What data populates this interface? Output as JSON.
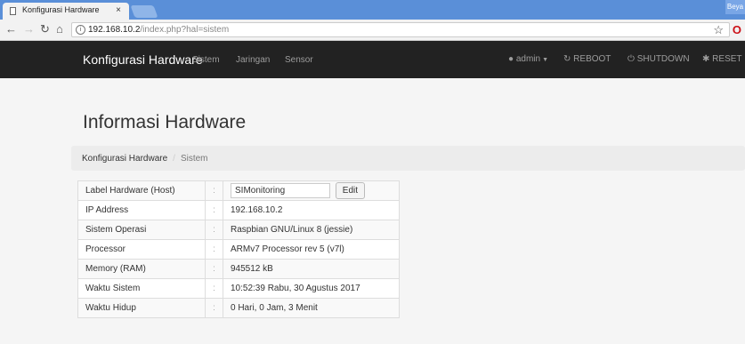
{
  "browser": {
    "tab_title": "Konfigurasi Hardware",
    "tab_close": "×",
    "window_user": "Beya",
    "url_host": "192.168.10.2",
    "url_rest": "/index.php?hal=sistem"
  },
  "navbar": {
    "brand": "Konfigurasi Hardware",
    "links": [
      "Sistem",
      "Jaringan",
      "Sensor"
    ],
    "user": "admin",
    "reboot": "REBOOT",
    "shutdown": "SHUTDOWN",
    "reset": "RESET"
  },
  "page": {
    "title": "Informasi Hardware",
    "breadcrumb": [
      "Konfigurasi Hardware",
      "Sistem"
    ],
    "breadcrumb_sep": "/"
  },
  "info_table": {
    "separator": ":",
    "host_label": "Label Hardware (Host)",
    "host_value": "SIMonitoring",
    "edit_label": "Edit",
    "rows": [
      {
        "label": "IP Address",
        "value": "192.168.10.2"
      },
      {
        "label": "Sistem Operasi",
        "value": "Raspbian GNU/Linux 8 (jessie)"
      },
      {
        "label": "Processor",
        "value": "ARMv7 Processor rev 5 (v7l)"
      },
      {
        "label": "Memory (RAM)",
        "value": "945512 kB"
      },
      {
        "label": "Waktu Sistem",
        "value": "10:52:39 Rabu, 30 Agustus 2017"
      },
      {
        "label": "Waktu Hidup",
        "value": "0 Hari, 0 Jam, 3 Menit"
      }
    ]
  }
}
